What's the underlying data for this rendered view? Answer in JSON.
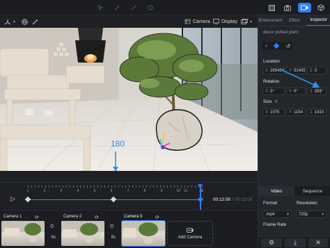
{
  "right_panel": {
    "tabs": [
      "Environment",
      "Effect",
      "Inspector"
    ],
    "active_tab": "Inspector",
    "object_name": "decor potted plant",
    "location": {
      "label": "Location",
      "x": "285454",
      "y": "51435",
      "z": "0"
    },
    "rotation": {
      "label": "Rotation",
      "x": "0°",
      "y": "0°",
      "z": "359°"
    },
    "size": {
      "label": "Size",
      "x": "1075",
      "y": "1154",
      "z": "1410"
    },
    "axis_x": "X",
    "axis_y": "Y",
    "axis_z": "Z"
  },
  "viewport": {
    "camera_label": "Camera",
    "display_label": "Display",
    "annotation_value": "180"
  },
  "timeline": {
    "ticks": [
      "1",
      "2",
      "3",
      "4",
      "5",
      "6",
      "7",
      "8",
      "9",
      "10",
      "11",
      "12"
    ],
    "current_time": "00:12:00",
    "total_time": "00:12:00",
    "separator": "/"
  },
  "clips": [
    {
      "title": "Camera 1",
      "duration": "6s"
    },
    {
      "title": "Camera 2",
      "duration": "6s"
    },
    {
      "title": "Camera 3",
      "duration": ""
    }
  ],
  "add_camera_label": "Add Camera",
  "export_panel": {
    "tabs": [
      "Video",
      "Sequence"
    ],
    "format_label": "Format",
    "resolution_label": "Resolution",
    "format_value": ".mp4",
    "resolution_value": "720p",
    "frame_rate_label": "Frame Rate"
  },
  "colors": {
    "accent": "#2f7cf6",
    "background": "#1e2024",
    "panel": "#23262b"
  }
}
